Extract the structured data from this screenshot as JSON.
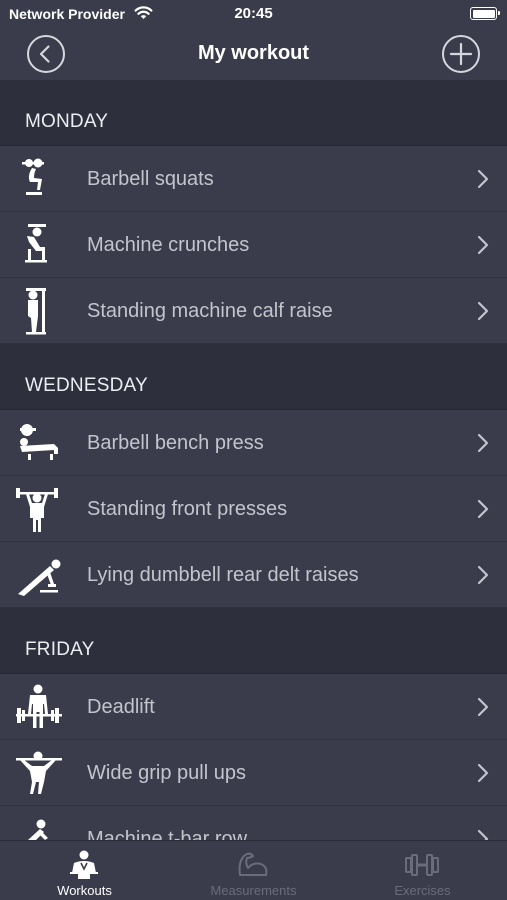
{
  "status_bar": {
    "carrier": "Network Provider",
    "time": "20:45"
  },
  "nav": {
    "title": "My workout"
  },
  "sections": [
    {
      "title": "MONDAY",
      "items": [
        {
          "label": "Barbell squats",
          "icon": "barbell-squat-icon"
        },
        {
          "label": "Machine crunches",
          "icon": "machine-crunch-icon"
        },
        {
          "label": "Standing machine calf raise",
          "icon": "calf-raise-icon"
        }
      ]
    },
    {
      "title": "WEDNESDAY",
      "items": [
        {
          "label": "Barbell bench press",
          "icon": "bench-press-icon"
        },
        {
          "label": "Standing front presses",
          "icon": "front-press-icon"
        },
        {
          "label": "Lying dumbbell rear delt raises",
          "icon": "rear-delt-raise-icon"
        }
      ]
    },
    {
      "title": "FRIDAY",
      "items": [
        {
          "label": "Deadlift",
          "icon": "deadlift-icon"
        },
        {
          "label": "Wide grip pull ups",
          "icon": "pull-up-icon"
        },
        {
          "label": "Machine t-bar row",
          "icon": "t-bar-row-icon"
        }
      ]
    }
  ],
  "tabs": [
    {
      "label": "Workouts",
      "icon": "workout-person-icon",
      "active": true
    },
    {
      "label": "Measurements",
      "icon": "flexed-arm-icon",
      "active": false
    },
    {
      "label": "Exercises",
      "icon": "dumbbell-icon",
      "active": false
    }
  ],
  "colors": {
    "background": "#2d2f3d",
    "row": "#3a3c4c",
    "text_primary": "#ffffff",
    "text_row": "#c3c5cc",
    "tab_inactive": "#6a6c7a"
  }
}
